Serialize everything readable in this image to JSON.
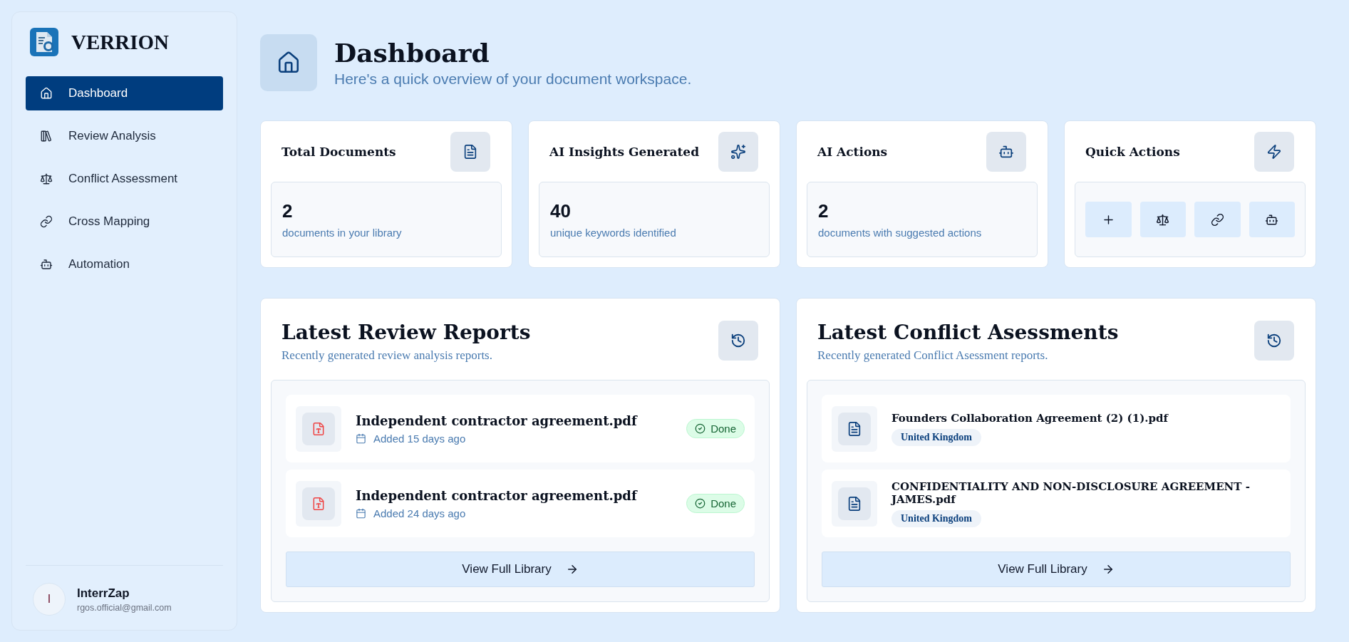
{
  "brand": {
    "name": "VERRION"
  },
  "nav": [
    {
      "label": "Dashboard",
      "selected": true
    },
    {
      "label": "Review Analysis",
      "selected": false
    },
    {
      "label": "Conflict Assessment",
      "selected": false
    },
    {
      "label": "Cross Mapping",
      "selected": false
    },
    {
      "label": "Automation",
      "selected": false
    }
  ],
  "user": {
    "initial": "I",
    "name": "InterrZap",
    "email": "rgos.official@gmail.com"
  },
  "header": {
    "title": "Dashboard",
    "subtitle": "Here's a quick overview of your document workspace."
  },
  "stats": [
    {
      "kind": "stat",
      "title": "Total Documents",
      "value": "2",
      "caption": "documents in your library"
    },
    {
      "kind": "stat",
      "title": "AI Insights Generated",
      "value": "40",
      "caption": "unique keywords identified"
    },
    {
      "kind": "stat",
      "title": "AI Actions",
      "value": "2",
      "caption": "documents with suggested actions"
    },
    {
      "kind": "actions",
      "title": "Quick Actions"
    }
  ],
  "panels": [
    {
      "kind": "reports",
      "title": "Latest Review Reports",
      "subtitle": "Recently generated review analysis reports.",
      "items": [
        {
          "name": "Independent contractor agreement.pdf",
          "date": "Added 15 days ago",
          "status": "Done"
        },
        {
          "name": "Independent contractor agreement.pdf",
          "date": "Added 24 days ago",
          "status": "Done"
        }
      ],
      "button": "View Full Library"
    },
    {
      "kind": "conflicts",
      "title": "Latest Conflict Asessments",
      "subtitle": "Recently generated Conflict Asessment reports.",
      "items": [
        {
          "name": "Founders Collaboration Agreement (2) (1).pdf",
          "tag": "United Kingdom"
        },
        {
          "name": "CONFIDENTIALITY AND NON-DISCLOSURE AGREEMENT - JAMES.pdf",
          "tag": "United Kingdom"
        }
      ],
      "button": "View Full Library"
    }
  ]
}
